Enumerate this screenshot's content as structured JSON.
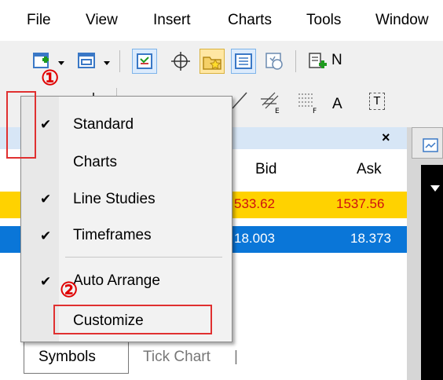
{
  "menubar": {
    "items": [
      "File",
      "View",
      "Insert",
      "Charts",
      "Tools",
      "Window"
    ]
  },
  "toolbar": {
    "partial_label": "N"
  },
  "toolbar2": {
    "text_tool": "A",
    "text_label_tool": "T"
  },
  "annotations": {
    "step1": "①",
    "step2": "②"
  },
  "market_watch": {
    "close": "×",
    "columns": {
      "bid": "Bid",
      "ask": "Ask"
    },
    "rows": [
      {
        "bid": "533.62",
        "ask": "1537.56",
        "color": "#ffd200"
      },
      {
        "bid": "18.003",
        "ask": "18.373",
        "color": "#0a76d8"
      }
    ],
    "tabs": [
      "Symbols",
      "Tick Chart"
    ],
    "tab_sep": "|"
  },
  "context_menu": {
    "items": [
      {
        "label": "Standard",
        "checked": true
      },
      {
        "label": "Charts",
        "checked": false
      },
      {
        "label": "Line Studies",
        "checked": true
      },
      {
        "label": "Timeframes",
        "checked": true
      },
      {
        "label": "Auto Arrange",
        "checked": true
      },
      {
        "label": "Customize",
        "checked": false
      }
    ],
    "check_glyph": "✔"
  },
  "colors": {
    "highlight": "#e03030",
    "yellow_row": "#ffd200",
    "blue_row": "#0a76d8"
  }
}
